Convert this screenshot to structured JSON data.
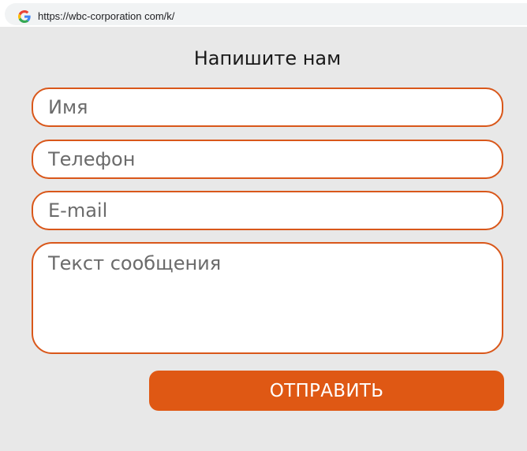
{
  "browser": {
    "url": "https://wbc-corporation com/k/",
    "site_icon": "google-g-icon"
  },
  "form": {
    "title": "Напишите нам",
    "name_placeholder": "Имя",
    "phone_placeholder": "Телефон",
    "email_placeholder": "E-mail",
    "message_placeholder": "Текст сообщения",
    "submit_label": "ОТПРАВИТЬ"
  },
  "colors": {
    "accent": "#df5814",
    "field_border": "#d9571a",
    "background": "#e8e8e8"
  }
}
